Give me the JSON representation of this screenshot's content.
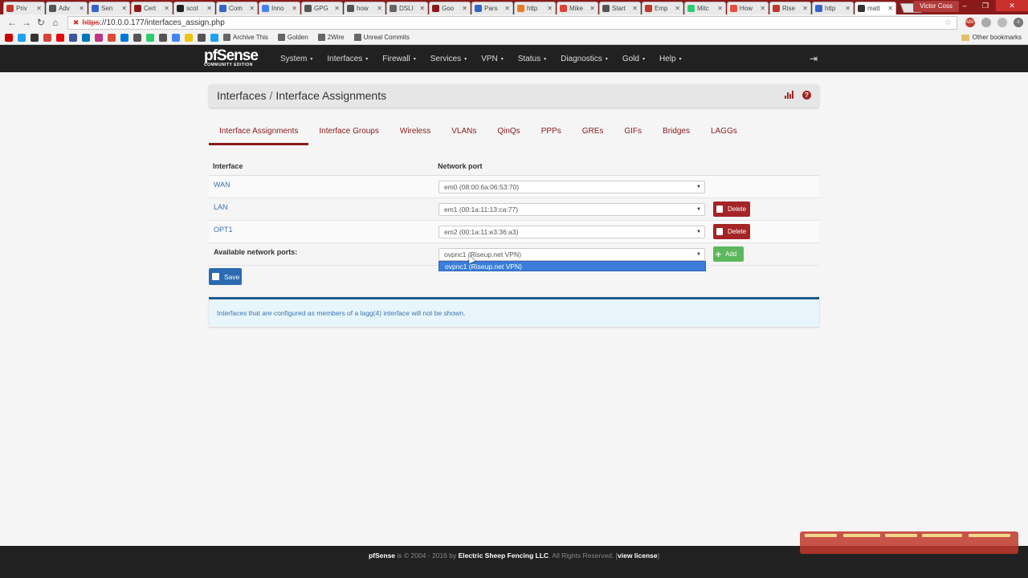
{
  "browser": {
    "tabs": [
      {
        "label": "Priv",
        "color": "#c0392b"
      },
      {
        "label": "Adv",
        "color": "#555555"
      },
      {
        "label": "Sen",
        "color": "#3366cc"
      },
      {
        "label": "Cert",
        "color": "#8a1a1a"
      },
      {
        "label": "scot",
        "color": "#222222"
      },
      {
        "label": "Com",
        "color": "#3366cc"
      },
      {
        "label": "Inno",
        "color": "#4285f4"
      },
      {
        "label": "GPG",
        "color": "#555555"
      },
      {
        "label": "how",
        "color": "#555555"
      },
      {
        "label": "DSLI",
        "color": "#666666"
      },
      {
        "label": "Goo",
        "color": "#8a1a1a"
      },
      {
        "label": "Pars",
        "color": "#3366cc"
      },
      {
        "label": "http",
        "color": "#e67e22"
      },
      {
        "label": "Mike",
        "color": "#db4437"
      },
      {
        "label": "Start",
        "color": "#555555"
      },
      {
        "label": "Emp",
        "color": "#c0392b"
      },
      {
        "label": "Mitc",
        "color": "#2ecc71"
      },
      {
        "label": "How",
        "color": "#e74c3c"
      },
      {
        "label": "Rise",
        "color": "#c0392b"
      },
      {
        "label": "http",
        "color": "#3366cc"
      },
      {
        "label": "matt",
        "color": "#333333",
        "active": true
      }
    ],
    "close_glyph": "✕",
    "profile_name": "Victor Coss",
    "window_buttons": {
      "minimize": "–",
      "maximize": "❐",
      "close": "✕"
    },
    "nav": {
      "back": "←",
      "forward": "→",
      "reload": "↻",
      "home": "⌂"
    },
    "url_protocol": "https",
    "url_rest": "://10.0.0.177/interfaces_assign.php",
    "lock_icon": "✖",
    "star_icon": "☆",
    "extensions": [
      {
        "label": "ABP",
        "color": "#c0392b"
      },
      {
        "label": "",
        "color": "#aaaaaa"
      },
      {
        "label": "",
        "color": "#bbbbbb"
      },
      {
        "label": "≡",
        "color": "#777777"
      }
    ],
    "bookmark_icons": [
      "#cc0000",
      "#1da1f2",
      "#333333",
      "#d44638",
      "#e50914",
      "#3b5998",
      "#0077b5",
      "#c13584",
      "#dd4b39",
      "#0078d7",
      "#555555",
      "#2ecc71",
      "#555555",
      "#4285f4",
      "#f1c40f",
      "#555555",
      "#1da1f2"
    ],
    "bookmarks": [
      "Archive This",
      "Golden",
      "2Wire",
      "Unreal Commits"
    ],
    "other_bookmarks": "Other bookmarks"
  },
  "pfnav": {
    "logo_main": "pfSense",
    "logo_sub": "COMMUNITY EDITION",
    "menu": [
      "System",
      "Interfaces",
      "Firewall",
      "Services",
      "VPN",
      "Status",
      "Diagnostics",
      "Gold",
      "Help"
    ],
    "caret": "▾",
    "logout_icon": "⇥"
  },
  "breadcrumb": {
    "parent": "Interfaces",
    "separator": "/",
    "current": "Interface Assignments"
  },
  "help_icon": "?",
  "tabs": [
    "Interface Assignments",
    "Interface Groups",
    "Wireless",
    "VLANs",
    "QinQs",
    "PPPs",
    "GREs",
    "GIFs",
    "Bridges",
    "LAGGs"
  ],
  "table": {
    "headers": {
      "interface": "Interface",
      "port": "Network port"
    },
    "rows": [
      {
        "name": "WAN",
        "port": "em0 (08:00:6a:06:53:70)",
        "deletable": false
      },
      {
        "name": "LAN",
        "port": "em1 (00:1a:11:13:ca:77)",
        "deletable": true
      },
      {
        "name": "OPT1",
        "port": "em2 (00:1a:11:e3:36:a3)",
        "deletable": true
      }
    ],
    "available_label": "Available network ports:",
    "available_value": "ovpnc1 (Riseup.net VPN)",
    "dropdown_option": "ovpnc1 (Riseup.net VPN)",
    "select_arrow": "▼"
  },
  "buttons": {
    "delete": "Delete",
    "add": "Add",
    "add_icon": "+",
    "save": "Save"
  },
  "info_text": "Interfaces that are configured as members of a lagg(4) interface will not be shown.",
  "footer": {
    "brand": "pfSense",
    "mid": " is © 2004 - 2016 by ",
    "company": "Electric Sheep Fencing LLC",
    "rights": ". All Rights Reserved. [",
    "license": "view license",
    "end": "]"
  },
  "colors": {
    "accent": "#8a1a1a",
    "link": "#3973ac",
    "danger": "#a32525",
    "success": "#5cb85c",
    "primary": "#2b6ab0",
    "navbar": "#212121"
  }
}
